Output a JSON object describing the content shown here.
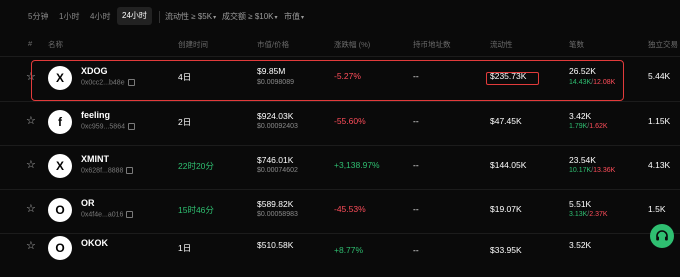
{
  "timeframes": [
    {
      "label": "5分钟",
      "active": false
    },
    {
      "label": "1小时",
      "active": false
    },
    {
      "label": "4小时",
      "active": false
    },
    {
      "label": "24小时",
      "active": true
    }
  ],
  "filters": [
    {
      "label": "流动性 ≥ $5K"
    },
    {
      "label": "成交额 ≥ $10K"
    },
    {
      "label": "市值"
    }
  ],
  "columns": {
    "num": "#",
    "name": "名称",
    "created": "创建时间",
    "mcap": "市值/价格",
    "change": "涨跌幅 (%)",
    "holders": "持币地址数",
    "liquidity": "流动性",
    "txns": "笔数",
    "volume": "独立交易"
  },
  "rows": [
    {
      "icon": "X",
      "name": "XDOG",
      "address": "0x0cc2...b48e",
      "age": "4日",
      "age_green": false,
      "mcap": "$9.85M",
      "price": "$0.0098089",
      "change": "-5.27%",
      "change_dir": "neg",
      "holders": "--",
      "liquidity": "$235.73K",
      "txns": "26.52K",
      "buys": "14.43K",
      "sells": "12.08K",
      "volume": "5.44K"
    },
    {
      "icon": "f",
      "name": "feeling",
      "address": "0xc959...5864",
      "age": "2日",
      "age_green": false,
      "mcap": "$924.03K",
      "price": "$0.00092403",
      "change": "-55.60%",
      "change_dir": "neg",
      "holders": "--",
      "liquidity": "$47.45K",
      "txns": "3.42K",
      "buys": "1.79K",
      "sells": "1.62K",
      "volume": "1.15K"
    },
    {
      "icon": "X",
      "name": "XMINT",
      "address": "0x628f...8888",
      "age": "22时20分",
      "age_green": true,
      "mcap": "$746.01K",
      "price": "$0.00074602",
      "change": "+3,138.97%",
      "change_dir": "pos",
      "holders": "--",
      "liquidity": "$144.05K",
      "txns": "23.54K",
      "buys": "10.17K",
      "sells": "13.36K",
      "volume": "4.13K"
    },
    {
      "icon": "O",
      "name": "OR",
      "address": "0x4f4e...a016",
      "age": "15时46分",
      "age_green": true,
      "mcap": "$589.82K",
      "price": "$0.00058983",
      "change": "-45.53%",
      "change_dir": "neg",
      "holders": "--",
      "liquidity": "$19.07K",
      "txns": "5.51K",
      "buys": "3.13K",
      "sells": "2.37K",
      "volume": "1.5K"
    },
    {
      "icon": "O",
      "name": "OKOK",
      "address": "",
      "age": "1日",
      "age_green": false,
      "mcap": "$510.58K",
      "price": "",
      "change": "+8.77%",
      "change_dir": "pos",
      "holders": "--",
      "liquidity": "$33.95K",
      "txns": "3.52K",
      "buys": "",
      "sells": "",
      "volume": ""
    }
  ]
}
